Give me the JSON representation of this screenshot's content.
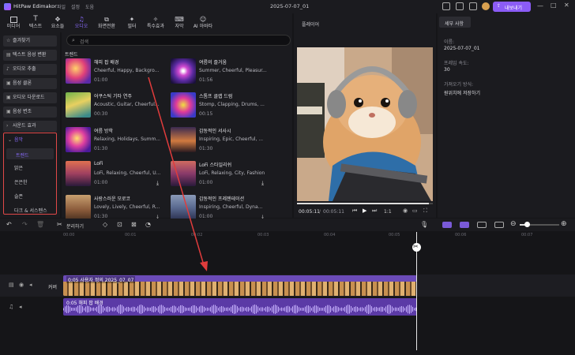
{
  "app": {
    "name": "HitPaw Edimakor",
    "menus": [
      "파일",
      "설정",
      "도움"
    ],
    "project_title": "2025-07-07_01",
    "export_label": "내보내기"
  },
  "toolbar": {
    "items": [
      {
        "label": "미디어",
        "icon": "media-icon"
      },
      {
        "label": "텍스트",
        "icon": "text-icon"
      },
      {
        "label": "요소들",
        "icon": "elements-icon"
      },
      {
        "label": "오디오",
        "icon": "audio-icon",
        "active": true
      },
      {
        "label": "화면전환",
        "icon": "transition-icon"
      },
      {
        "label": "필터",
        "icon": "filter-icon"
      },
      {
        "label": "특수효과",
        "icon": "effects-icon"
      },
      {
        "label": "자막",
        "icon": "subtitle-icon"
      },
      {
        "label": "AI 아바타",
        "icon": "ai-avatar-icon"
      }
    ]
  },
  "sidebar": {
    "items": [
      "즐겨찾기",
      "텍스트 음성 변환",
      "오디오 추출",
      "음성 클론",
      "오디오 다운로드",
      "음성 변조",
      "사운드 효과",
      "음악"
    ],
    "music_sub": [
      "트렌드",
      "밝은",
      "은은한",
      "슬픈",
      "다크 & 서스펜스"
    ]
  },
  "library": {
    "search_placeholder": "검색",
    "section": "트렌드",
    "tracks": [
      {
        "title": "해피 팝 배경",
        "tags": "Cheerful, Happy, Backgro...",
        "duration": "01:00"
      },
      {
        "title": "여름의 즐거움",
        "tags": "Summer, Cheerful, Pleasur...",
        "duration": "01:56"
      },
      {
        "title": "어쿠스틱 기타 연주",
        "tags": "Acoustic, Guitar, Cheerful...",
        "duration": "00:30"
      },
      {
        "title": "스톰프 클랩 드럼",
        "tags": "Stomp, Clapping, Drums, ...",
        "duration": "00:15"
      },
      {
        "title": "여름 방학",
        "tags": "Relaxing, Holidays, Summ...",
        "duration": "01:30"
      },
      {
        "title": "감동적인 서사시",
        "tags": "Inspiring, Epic, Cheerful, ...",
        "duration": "01:30"
      },
      {
        "title": "LoFi",
        "tags": "LoFi, Relaxing, Cheerful, U...",
        "duration": "01:00"
      },
      {
        "title": "LoFi 스타일리쉬",
        "tags": "LoFi, Relaxing, City, Fashion",
        "duration": "01:00"
      },
      {
        "title": "사랑스러운 모로코",
        "tags": "Lovely, Lively, Cheerful, R...",
        "duration": "01:30"
      },
      {
        "title": "감동적인 프레젠테이션",
        "tags": "Inspiring, Cheerful, Dyna...",
        "duration": "01:00"
      }
    ]
  },
  "player": {
    "title": "플레이어",
    "current": "00:05:11",
    "total": "00:05:11",
    "speed": "1:1",
    "progress": 0.97
  },
  "details": {
    "tab": "세부 사항",
    "fields": [
      {
        "label": "이름:",
        "value": "2025-07-07_01"
      },
      {
        "label": "프레임 속도:",
        "value": "30"
      },
      {
        "label": "가져오기 방식:",
        "value": "원위치에 저장하기"
      }
    ]
  },
  "timeline": {
    "split_label": "분리하기",
    "ruler": [
      "00:00",
      "00:01",
      "00:02",
      "00:03",
      "00:04",
      "00:05",
      "00:06",
      "00:07"
    ],
    "cover_label": "커버",
    "video_clip": "0:05 사용자 정의 2025_07_07",
    "audio_clip": "0:05 해피 팝 배경"
  },
  "colors": {
    "accent": "#8b6cff",
    "clip": "#6b4bb8",
    "audio": "#5b3aa6",
    "highlight_border": "#e04848",
    "arrow": "#e03c3c"
  }
}
